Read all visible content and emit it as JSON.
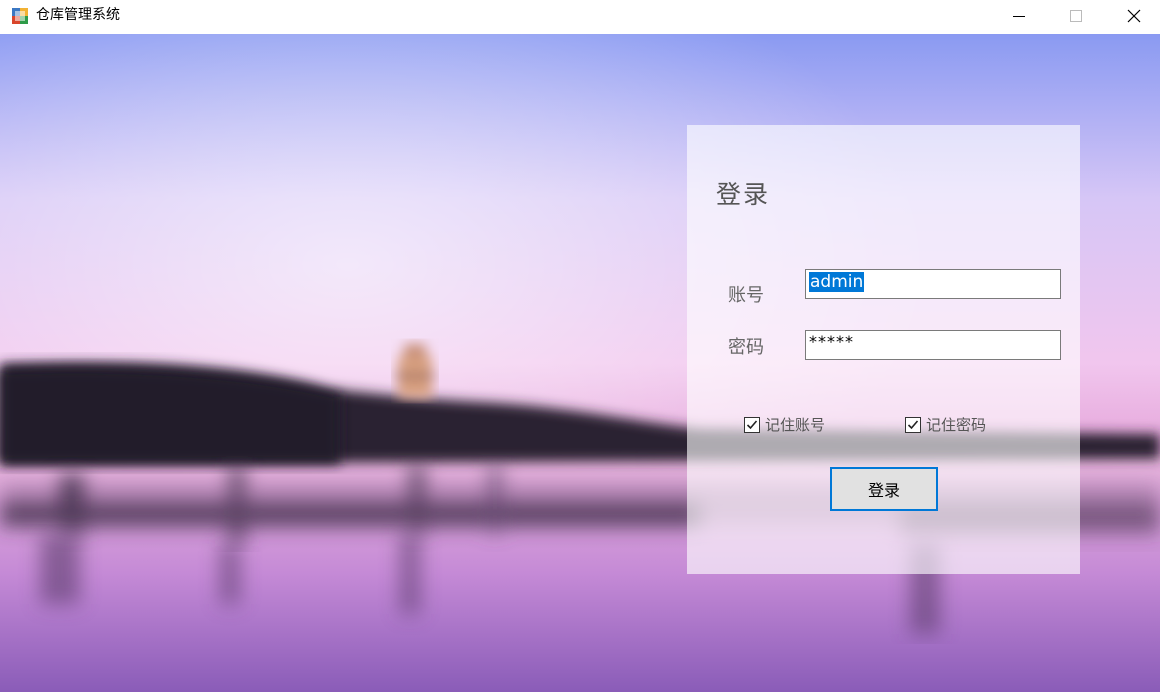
{
  "window": {
    "title": "仓库管理系统",
    "icon": "app-icon"
  },
  "login": {
    "title": "登录",
    "account_label": "账号",
    "password_label": "密码",
    "account_value": "admin",
    "password_value": "*****",
    "remember_account": {
      "label": "记住账号",
      "checked": true
    },
    "remember_password": {
      "label": "记住密码",
      "checked": true
    },
    "submit_label": "登录"
  },
  "colors": {
    "accent": "#0078d7",
    "sky_top": "#8a9af0",
    "sky_pink": "#e6b6e6",
    "water": "#c88fd8"
  }
}
